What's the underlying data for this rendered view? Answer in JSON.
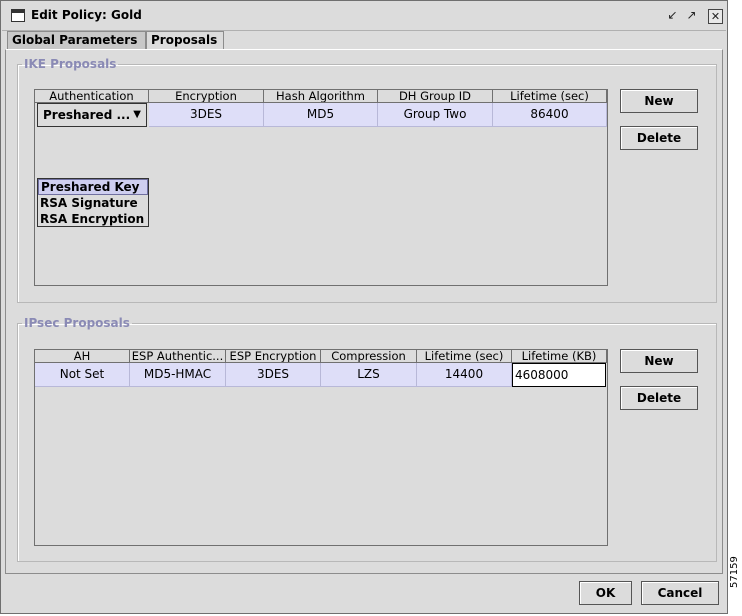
{
  "window": {
    "title": "Edit Policy: Gold"
  },
  "tabs": [
    {
      "label": "Global Parameters"
    },
    {
      "label": "Proposals"
    }
  ],
  "ike": {
    "legend": "IKE Proposals",
    "columns": [
      "Authentication",
      "Encryption",
      "Hash Algorithm",
      "DH Group ID",
      "Lifetime (sec)"
    ],
    "row": {
      "authentication": "Preshared ...",
      "encryption": "3DES",
      "hash": "MD5",
      "dh_group": "Group Two",
      "lifetime": "86400"
    },
    "auth_options": [
      "Preshared Key",
      "RSA Signature",
      "RSA Encryption"
    ],
    "buttons": {
      "new": "New",
      "delete": "Delete"
    }
  },
  "ipsec": {
    "legend": "IPsec Proposals",
    "columns": [
      "AH",
      "ESP Authentic...",
      "ESP Encryption",
      "Compression",
      "Lifetime (sec)",
      "Lifetime (KB)"
    ],
    "row": {
      "ah": "Not Set",
      "esp_auth": "MD5-HMAC",
      "esp_enc": "3DES",
      "compression": "LZS",
      "lifetime_sec": "14400",
      "lifetime_kb": "4608000"
    },
    "buttons": {
      "new": "New",
      "delete": "Delete"
    }
  },
  "footer": {
    "ok": "OK",
    "cancel": "Cancel"
  },
  "figure_code": "57159"
}
